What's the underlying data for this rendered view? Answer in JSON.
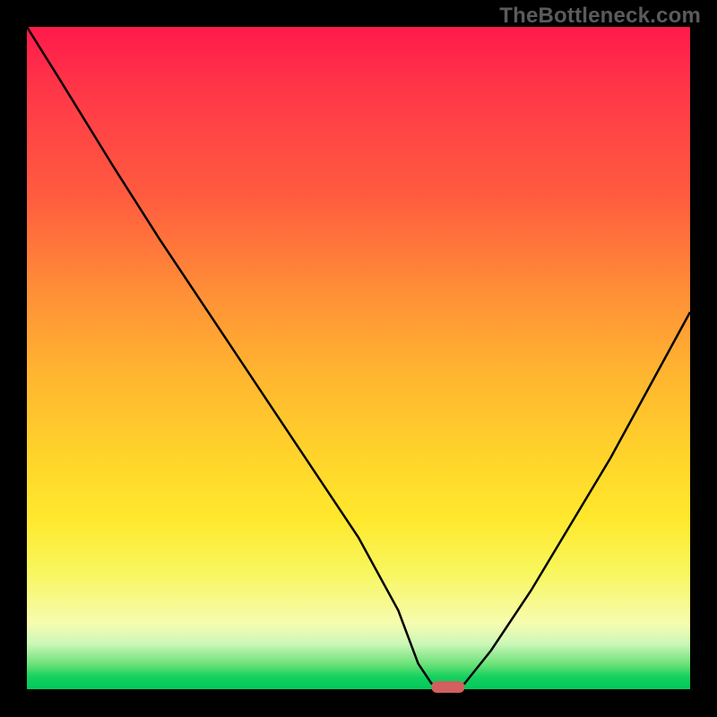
{
  "watermark": "TheBottleneck.com",
  "colors": {
    "gradient_top": "#ff1a4a",
    "gradient_mid1": "#ff8f37",
    "gradient_mid2": "#ffe82c",
    "gradient_bottom": "#00c85a",
    "curve": "#000000",
    "marker": "#d1605e",
    "frame": "#000000",
    "watermark": "#5b5b5b"
  },
  "chart_data": {
    "type": "line",
    "title": "",
    "xlabel": "",
    "ylabel": "",
    "xlim": [
      0,
      100
    ],
    "ylim": [
      0,
      100
    ],
    "grid": false,
    "legend": false,
    "comment": "Curve depicts bottleneck percentage vs. a swept parameter. Minimum (green zone, ~0%) around x≈61–66. Values read from vertical position against the color gradient (red≈100%, green≈0%).",
    "series": [
      {
        "name": "bottleneck_curve",
        "x": [
          0,
          5,
          13,
          20,
          28,
          36,
          44,
          50,
          56,
          59,
          61,
          64,
          66,
          70,
          76,
          82,
          88,
          94,
          100
        ],
        "y": [
          100,
          92,
          79,
          68,
          56,
          44,
          32,
          23,
          12,
          4,
          1,
          0,
          1,
          6,
          15,
          25,
          35,
          46,
          57
        ]
      }
    ],
    "marker": {
      "shape": "rounded_rect",
      "x_range": [
        61,
        66
      ],
      "y": 0,
      "color": "#d1605e"
    },
    "background_gradient": {
      "direction": "vertical",
      "stops": [
        {
          "pos": 0.0,
          "color": "#ff1a4a"
        },
        {
          "pos": 0.4,
          "color": "#ff8f37"
        },
        {
          "pos": 0.74,
          "color": "#ffe82c"
        },
        {
          "pos": 0.9,
          "color": "#f6fcb0"
        },
        {
          "pos": 1.0,
          "color": "#00c85a"
        }
      ]
    }
  }
}
